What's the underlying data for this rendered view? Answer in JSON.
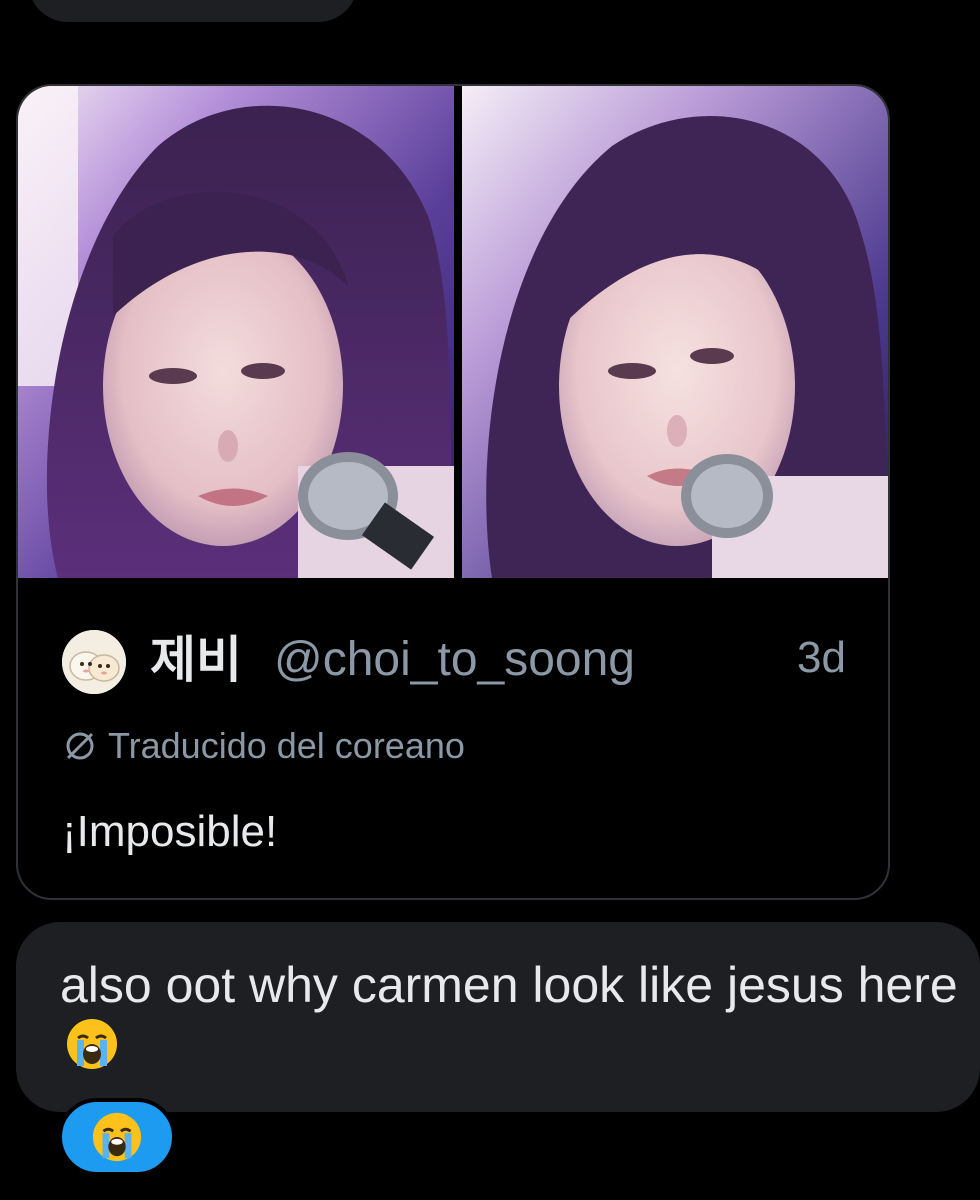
{
  "quoted_tweet": {
    "author_name": "제비",
    "author_handle": "@choi_to_soong",
    "time_ago": "3d",
    "translation_label": "Traducido del coreano",
    "text": "¡Imposible!",
    "media": [
      {
        "icon": "photo-performer-with-microphone"
      },
      {
        "icon": "photo-performer-with-microphone"
      }
    ]
  },
  "message": {
    "text": "also oot why carmen look like jesus here",
    "emoji": "loudly-crying-face-icon"
  },
  "reaction": {
    "emoji": "loudly-crying-face-icon",
    "color": "#1d9bf0"
  },
  "colors": {
    "background": "#000000",
    "bubble": "#1e1f22",
    "secondary_text": "#8b98a5",
    "card_border": "#2f3336"
  }
}
